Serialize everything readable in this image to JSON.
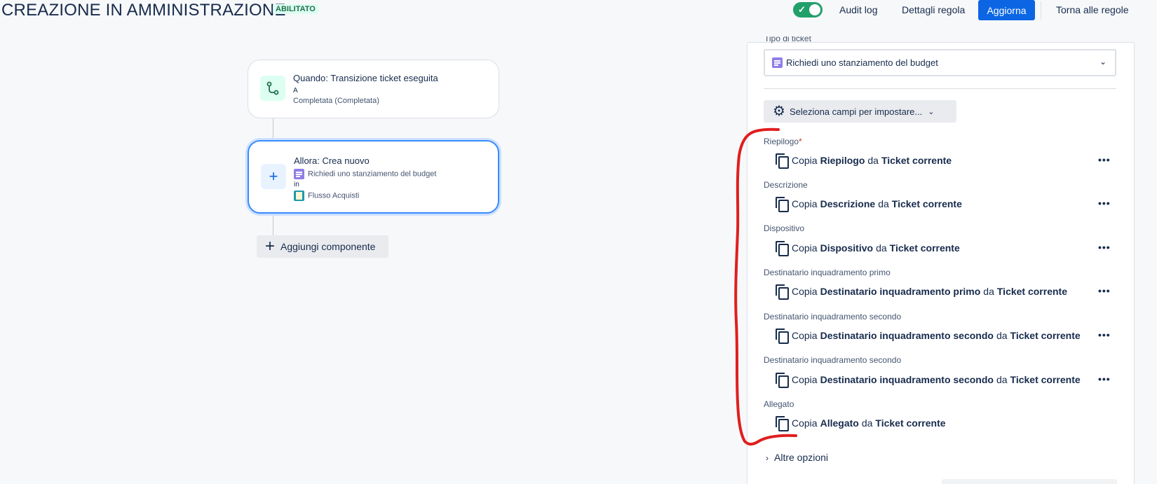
{
  "header": {
    "title": "CREAZIONE IN AMMINISTRAZIONE",
    "status_badge": "ABILITATO",
    "toggle_icon": "check-icon",
    "audit_log": "Audit log",
    "rule_details": "Dettagli regola",
    "update": "Aggiorna",
    "back_to_rules": "Torna alle regole"
  },
  "canvas": {
    "trigger": {
      "title": "Quando: Transizione ticket eseguita",
      "line1": "A",
      "line2": "Completata (Completata)",
      "icon": "branch-icon"
    },
    "action": {
      "title": "Allora: Crea nuovo",
      "line1": "Richiedi uno stanziamento del budget",
      "line2": "in",
      "line3": "Flusso Acquisti",
      "icon": "plus-icon"
    },
    "add_component": "Aggiungi componente"
  },
  "panel": {
    "cut_label": "Tipo di ticket",
    "issue_type": "Richiedi uno stanziamento del budget",
    "fields_button": "Seleziona campi per impostare...",
    "fields": [
      {
        "label": "Riepilogo",
        "required": "*",
        "copy": "Copia",
        "field": "Riepilogo",
        "from": "da",
        "source": "Ticket corrente"
      },
      {
        "label": "Descrizione",
        "copy": "Copia",
        "field": "Descrizione",
        "from": "da",
        "source": "Ticket corrente"
      },
      {
        "label": "Dispositivo",
        "copy": "Copia",
        "field": "Dispositivo",
        "from": "da",
        "source": "Ticket corrente"
      },
      {
        "label": "Destinatario inquadramento primo",
        "copy": "Copia",
        "field": "Destinatario inquadramento primo",
        "from": "da",
        "source": "Ticket corrente"
      },
      {
        "label": "Destinatario inquadramento secondo",
        "copy": "Copia",
        "field": "Destinatario inquadramento secondo",
        "from": "da",
        "source": "Ticket corrente"
      },
      {
        "label": "Destinatario inquadramento secondo",
        "copy": "Copia",
        "field": "Destinatario inquadramento secondo",
        "from": "da",
        "source": "Ticket corrente"
      },
      {
        "label": "Allegato",
        "copy": "Copia",
        "field": "Allegato",
        "from": "da",
        "source": "Ticket corrente"
      }
    ],
    "more_menu": "•••",
    "more_options": "Altre opzioni"
  },
  "colors": {
    "primary": "#0c66e4",
    "toggle_on": "#22a06b",
    "annotation": "#e01e1e"
  }
}
